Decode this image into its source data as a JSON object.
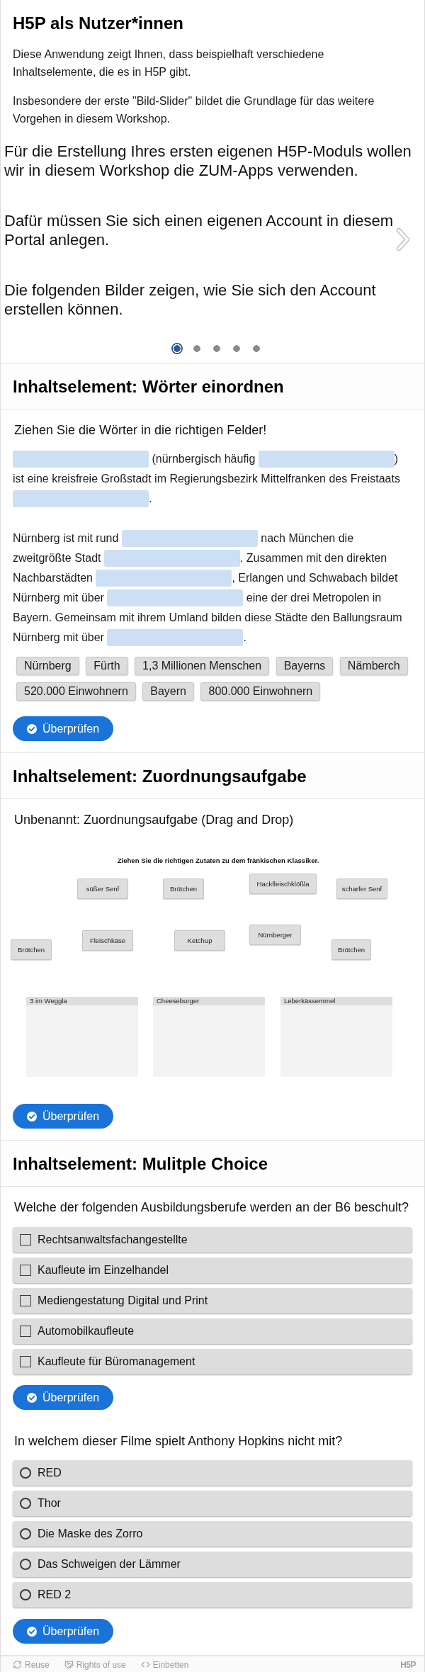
{
  "intro": {
    "title": "H5P als Nutzer*innen",
    "paragraphs": [
      "Diese Anwendung zeigt Ihnen, dass beispielhaft verschiedene Inhaltselemente, die es in H5P gibt.",
      "Insbesondere der erste \"Bild-Slider\" bildet die Grundlage für das weitere Vorgehen in diesem Workshop."
    ]
  },
  "image_slider": {
    "slide_paragraphs": [
      "Für die Erstellung Ihres ersten eigenen H5P-Moduls wollen wir in diesem Workshop die ZUM-Apps verwenden.",
      "Dafür müssen Sie sich einen eigenen Account in diesem Portal anlegen.",
      "Die folgenden Bilder zeigen, wie Sie sich den Account erstellen können."
    ],
    "dots": [
      {
        "selected": true
      },
      {
        "selected": false
      },
      {
        "selected": false
      },
      {
        "selected": false
      },
      {
        "selected": false
      }
    ]
  },
  "sections": [
    {
      "kind": "drag_text",
      "title": "Inhaltselement: Wörter einordnen",
      "task": "Ziehen Sie die Wörter in die richtigen Felder!",
      "paragraphs": [
        [
          [
            {
              "kind": "blank"
            },
            {
              "kind": "text",
              "text": " (nürnbergisch häufig "
            },
            {
              "kind": "blank"
            },
            {
              "kind": "text",
              "text": ")"
            }
          ],
          [
            {
              "kind": "text",
              "text": "ist eine kreisfreie Großstadt im Regierungsbezirk Mittelfranken des Freistaats"
            }
          ],
          [
            {
              "kind": "blank"
            },
            {
              "kind": "text",
              "text": "."
            }
          ]
        ],
        [
          [
            {
              "kind": "text",
              "text": "Nürnberg ist mit rund "
            },
            {
              "kind": "blank"
            },
            {
              "kind": "text",
              "text": " nach München die"
            }
          ],
          [
            {
              "kind": "text",
              "text": "zweitgrößte Stadt "
            },
            {
              "kind": "blank"
            },
            {
              "kind": "text",
              "text": ". Zusammen mit den direkten"
            }
          ],
          [
            {
              "kind": "text",
              "text": "Nachbarstädten "
            },
            {
              "kind": "blank"
            },
            {
              "kind": "text",
              "text": ", Erlangen und Schwabach bildet"
            }
          ],
          [
            {
              "kind": "text",
              "text": "Nürnberg mit über "
            },
            {
              "kind": "blank"
            },
            {
              "kind": "text",
              "text": " eine der drei Metropolen in"
            }
          ],
          [
            {
              "kind": "text",
              "text": "Bayern. Gemeinsam mit ihrem Umland bilden diese Städte den Ballungsraum"
            }
          ],
          [
            {
              "kind": "text",
              "text": "Nürnberg mit über "
            },
            {
              "kind": "blank"
            },
            {
              "kind": "text",
              "text": "."
            }
          ]
        ]
      ],
      "words": [
        "Nürnberg",
        "Fürth",
        "1,3 Millionen Menschen",
        "Bayerns",
        "Nämberch",
        "520.000 Einwohnern",
        "Bayern",
        "800.000 Einwohnern"
      ],
      "button": "Überprüfen"
    },
    {
      "kind": "drag_drop",
      "title": "Inhaltselement: Zuordnungsaufgabe",
      "task": "Unbenannt: Zuordnungsaufgabe (Drag and Drop)",
      "instruction": "Ziehen Sie die richtigen Zutaten zu dem fränkischen Klassiker.",
      "draggables": [
        "süßer Senf",
        "Brötchen",
        "Hackfleischklößla",
        "scharfer Senf",
        "Brötchen",
        "Fleischkäse",
        "Ketchup",
        "Nürnberger",
        "Brötchen"
      ],
      "drop_zones": [
        "3 im Weggla",
        "Cheeseburger",
        "Leberkässemmel"
      ],
      "button": "Überprüfen"
    },
    {
      "kind": "choice",
      "title": "Inhaltselement: Mulitple Choice",
      "questions": [
        {
          "kind": "multiple",
          "question": "Welche der folgenden Ausbildungsberufe werden an der B6 beschult?",
          "options": [
            {
              "label": "Rechtsanwaltsfachangestellte",
              "checked": false
            },
            {
              "label": "Kaufleute im Einzelhandel",
              "checked": false
            },
            {
              "label": "Mediengestatung Digital und Print",
              "checked": false
            },
            {
              "label": "Automobilkaufleute",
              "checked": false
            },
            {
              "label": "Kaufleute für Büromanagement",
              "checked": false
            }
          ],
          "button": "Überprüfen"
        },
        {
          "kind": "single",
          "question": "In welchem dieser Filme spielt Anthony Hopkins nicht mit?",
          "options": [
            {
              "label": "RED",
              "selected": false
            },
            {
              "label": "Thor",
              "selected": false
            },
            {
              "label": "Die Maske des Zorro",
              "selected": false
            },
            {
              "label": "Das Schweigen der Lämmer",
              "selected": false
            },
            {
              "label": "RED 2",
              "selected": false
            }
          ],
          "button": "Überprüfen"
        }
      ]
    }
  ],
  "footer": {
    "actions": [
      {
        "kind": "reuse",
        "label": "Reuse"
      },
      {
        "kind": "rights",
        "label": "Rights of use"
      },
      {
        "kind": "embed",
        "label": "Einbetten"
      }
    ],
    "logo": "H5P"
  }
}
